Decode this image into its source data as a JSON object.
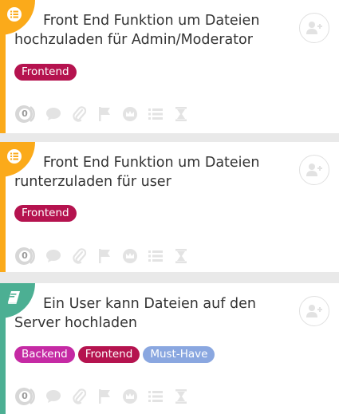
{
  "cards": [
    {
      "title": "Front End Funktion um Dateien hochzuladen für Admin/Moderator",
      "type_icon": "list-icon",
      "accent": "#fbaa1a",
      "tags": [
        {
          "label": "Frontend",
          "color": "#b5134f"
        }
      ],
      "comment_count": "0"
    },
    {
      "title": "Front End Funktion um Dateien runterzuladen für user",
      "type_icon": "list-icon",
      "accent": "#fbaa1a",
      "tags": [
        {
          "label": "Frontend",
          "color": "#b5134f"
        }
      ],
      "comment_count": "0"
    },
    {
      "title": "Ein User kann Dateien auf den Server hochladen",
      "type_icon": "book-icon",
      "accent": "#4caf93",
      "tags": [
        {
          "label": "Backend",
          "color": "#c52aa4"
        },
        {
          "label": "Frontend",
          "color": "#b5134f"
        },
        {
          "label": "Must-Have",
          "color": "#8aa7e0"
        }
      ],
      "comment_count": "0"
    }
  ],
  "toolbar_icons": [
    "comment-icon",
    "attachment-icon",
    "flag-icon",
    "crown-icon",
    "checklist-icon",
    "hourglass-icon"
  ]
}
